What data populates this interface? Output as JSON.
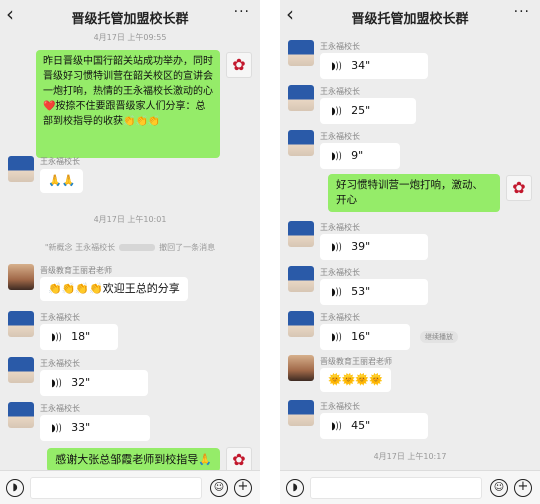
{
  "chat": {
    "title": "晋级托管加盟校长群",
    "back_icon": "chevron-left-icon",
    "more_icon": "more-dots-icon"
  },
  "left": {
    "time1": "4月17日 上午09:55",
    "msg_long": "昨日晋级中国行韶关站成功举办，同时晋级好习惯特训营在韶关校区的宣讲会一炮打响，热情的王永福校长激动的心❤️按捺不住要跟晋级家人们分享：总部到校指导的收获👏👏👏",
    "sender_wang": "王永福校长",
    "msg_clap": "🙏🙏",
    "time2": "4月17日 上午10:01",
    "recall_prefix": "\"新概念 王永福校长",
    "recall_suffix": "撤回了一条消息",
    "sender_teacher": "晋级教育王丽君老师",
    "msg_share": "👏👏👏👏欢迎王总的分享",
    "voice1": "18\"",
    "voice2": "32\"",
    "voice3": "33\"",
    "msg_thanks": "感谢大张总邹霞老师到校指导🙏"
  },
  "right": {
    "voice1": "34\"",
    "voice2": "25\"",
    "voice3": "9\"",
    "msg_hot": "好习惯特训营一炮打响，激动、开心",
    "voice4": "39\"",
    "voice5": "53\"",
    "voice6": "16\"",
    "continue_label": "继续播放",
    "sender_teacher": "晋级教育王丽君老师",
    "msg_sun": "🌞🌞🌞🌞",
    "voice7": "45\"",
    "time": "4月17日 上午10:17"
  },
  "colors": {
    "chat_bg": "#ededed",
    "green_bubble": "#95ec69",
    "white_bubble": "#ffffff"
  },
  "icons": {
    "voice_mode": "voice-mode-icon",
    "emoji": "emoji-icon",
    "plus": "plus-icon",
    "voice_wave": "voice-wave-icon",
    "rose_avatar": "rose-avatar-icon"
  }
}
